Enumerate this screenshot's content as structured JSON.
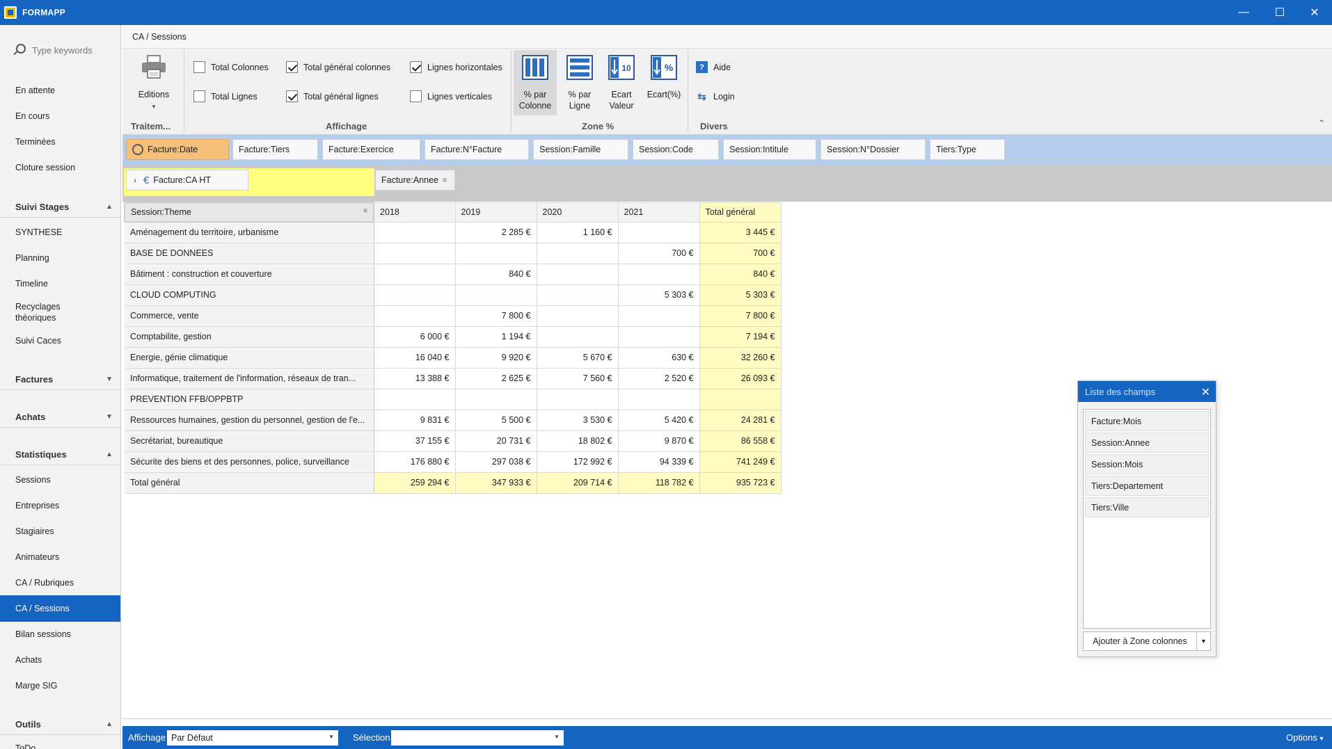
{
  "window": {
    "title": "FORMAPP",
    "minimize": "—",
    "maximize": "☐",
    "close": "✕"
  },
  "search": {
    "placeholder": "Type keywords"
  },
  "sidebar": {
    "top_items": [
      "En attente",
      "En cours",
      "Terminées",
      "Cloture session"
    ],
    "suivi_stages": {
      "label": "Suivi Stages",
      "items": [
        "SYNTHESE",
        "Planning",
        "Timeline",
        "Recyclages théoriques",
        "Suivi Caces"
      ]
    },
    "factures": {
      "label": "Factures"
    },
    "achats": {
      "label": "Achats"
    },
    "statistiques": {
      "label": "Statistiques",
      "items": [
        "Sessions",
        "Entreprises",
        "Stagiaires",
        "Animateurs",
        "CA / Rubriques",
        "CA / Sessions",
        "Bilan sessions",
        "Achats",
        "Marge SIG"
      ]
    },
    "outils": {
      "label": "Outils",
      "items": [
        "ToDo"
      ]
    }
  },
  "breadcrumb": "CA / Sessions",
  "ribbon": {
    "traitements": {
      "label": "Traitem...",
      "editions": "Editions"
    },
    "affichage": {
      "label": "Affichage",
      "checks": [
        {
          "label": "Total Colonnes",
          "checked": false
        },
        {
          "label": "Total Lignes",
          "checked": false
        },
        {
          "label": "Total général colonnes",
          "checked": true
        },
        {
          "label": "Total général lignes",
          "checked": true
        },
        {
          "label": "Lignes horizontales",
          "checked": true
        },
        {
          "label": "Lignes verticales",
          "checked": false
        }
      ]
    },
    "zone": {
      "label": "Zone %",
      "pct_colonne": "% par Colonne",
      "pct_ligne": "% par Ligne",
      "ecart_valeur": "Ecart Valeur",
      "ecart_pct": "Ecart(%)",
      "icon_10": "10",
      "icon_pct": "%"
    },
    "divers": {
      "label": "Divers",
      "aide": "Aide",
      "login": "Login"
    },
    "collapse": "⌃"
  },
  "filter_fields": [
    "Facture:Date",
    "Facture:Tiers",
    "Facture:Exercice",
    "Facture:N°Facture",
    "Session:Famille",
    "Session:Code",
    "Session:Intitule",
    "Session:N°Dossier",
    "Tiers:Type"
  ],
  "data_field": {
    "label": "Facture:CA HT",
    "expander": "›",
    "currency_icon": "€"
  },
  "column_field": "Facture:Annee",
  "row_field": "Session:Theme",
  "pivot": {
    "columns": [
      "2018",
      "2019",
      "2020",
      "2021",
      "Total général"
    ],
    "rows": [
      {
        "label": "Aménagement du territoire, urbanisme",
        "values": [
          "",
          "2 285 €",
          "1 160 €",
          "",
          "3 445 €"
        ]
      },
      {
        "label": "BASE DE DONNEES",
        "values": [
          "",
          "",
          "",
          "700 €",
          "700 €"
        ]
      },
      {
        "label": "Bâtiment : construction et couverture",
        "values": [
          "",
          "840 €",
          "",
          "",
          "840 €"
        ]
      },
      {
        "label": "CLOUD COMPUTING",
        "values": [
          "",
          "",
          "",
          "5 303 €",
          "5 303 €"
        ]
      },
      {
        "label": "Commerce, vente",
        "values": [
          "",
          "7 800 €",
          "",
          "",
          "7 800 €"
        ]
      },
      {
        "label": "Comptabilite, gestion",
        "values": [
          "6 000 €",
          "1 194 €",
          "",
          "",
          "7 194 €"
        ]
      },
      {
        "label": "Energie, génie climatique",
        "values": [
          "16 040 €",
          "9 920 €",
          "5 670 €",
          "630 €",
          "32 260 €"
        ]
      },
      {
        "label": "Informatique, traitement de l'information, réseaux de tran...",
        "values": [
          "13 388 €",
          "2 625 €",
          "7 560 €",
          "2 520 €",
          "26 093 €"
        ]
      },
      {
        "label": "PREVENTION FFB/OPPBTP",
        "values": [
          "",
          "",
          "",
          "",
          ""
        ]
      },
      {
        "label": "Ressources humaines, gestion du personnel, gestion de l'e...",
        "values": [
          "9 831 €",
          "5 500 €",
          "3 530 €",
          "5 420 €",
          "24 281 €"
        ]
      },
      {
        "label": "Secrétariat, bureautique",
        "values": [
          "37 155 €",
          "20 731 €",
          "18 802 €",
          "9 870 €",
          "86 558 €"
        ]
      },
      {
        "label": "Sécurite des biens et des personnes, police, surveillance",
        "values": [
          "176 880 €",
          "297 038 €",
          "172 992 €",
          "94 339 €",
          "741 249 €"
        ]
      }
    ],
    "grand_total": {
      "label": "Total général",
      "values": [
        "259 294 €",
        "347 933 €",
        "209 714 €",
        "118 782 €",
        "935 723 €"
      ]
    }
  },
  "field_list": {
    "title": "Liste des champs",
    "close": "✕",
    "items": [
      "Facture:Mois",
      "Session:Annee",
      "Session:Mois",
      "Tiers:Departement",
      "Tiers:Ville"
    ],
    "add_button": "Ajouter à Zone colonnes",
    "add_arrow": "▼"
  },
  "bottombar": {
    "affichage_label": "Affichage",
    "affichage_value": "Par Défaut",
    "selection_label": "Sélection",
    "selection_value": "",
    "options": "Options",
    "options_arrow": "▾",
    "combo_arrow": "▼"
  },
  "colors": {
    "accent": "#1565c0",
    "total_yellow": "#fffbc2",
    "selected_chip": "#f5c07a",
    "filter_blue": "#b6cdeb"
  }
}
